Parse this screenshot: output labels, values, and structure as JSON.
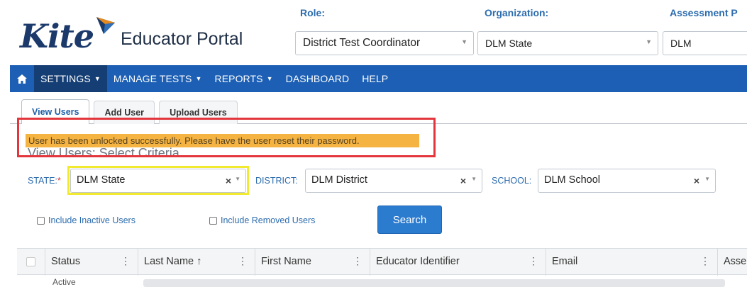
{
  "header": {
    "logo_text": "Kite",
    "portal_name": "Educator Portal",
    "role": {
      "label": "Role:",
      "value": "District Test Coordinator"
    },
    "organization": {
      "label": "Organization:",
      "value": "DLM State"
    },
    "assessment": {
      "label": "Assessment P",
      "value": "DLM"
    }
  },
  "nav": {
    "items": [
      {
        "label": "SETTINGS",
        "dropdown": true,
        "active": true
      },
      {
        "label": "MANAGE TESTS",
        "dropdown": true
      },
      {
        "label": "REPORTS",
        "dropdown": true
      },
      {
        "label": "DASHBOARD",
        "dropdown": false
      },
      {
        "label": "HELP",
        "dropdown": false
      }
    ]
  },
  "tabs": [
    "View Users",
    "Add User",
    "Upload Users"
  ],
  "alert": {
    "message": "User has been unlocked successfully. Please have the user reset their password."
  },
  "section_title": "View Users: Select Criteria",
  "filters": {
    "state": {
      "label": "STATE:",
      "required_mark": "*",
      "value": "DLM State"
    },
    "district": {
      "label": "DISTRICT:",
      "value": "DLM District"
    },
    "school": {
      "label": "SCHOOL:",
      "value": "DLM School"
    },
    "include_inactive": "Include Inactive Users",
    "include_removed": "Include Removed Users",
    "search_label": "Search"
  },
  "grid": {
    "columns": [
      "Status",
      "Last Name ↑",
      "First Name",
      "Educator Identifier",
      "Email",
      "Asse"
    ],
    "first_row_status": "Active"
  },
  "colors": {
    "nav_bg": "#1c5fb4",
    "nav_active": "#153e74",
    "link_blue": "#2c6cae",
    "alert_bg": "#f5b342",
    "callout_red": "#e2363c",
    "highlight_yellow": "#f2ea2e",
    "button_blue": "#2b7bcf"
  }
}
